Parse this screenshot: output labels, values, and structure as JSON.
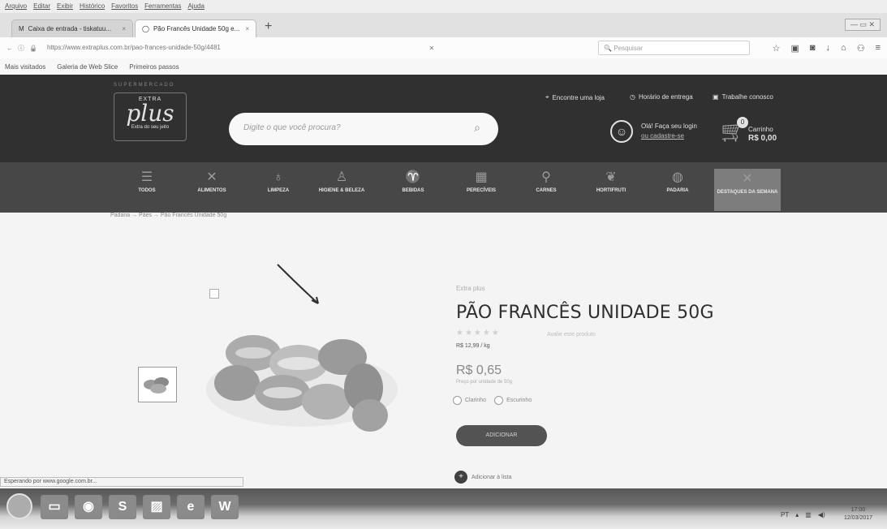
{
  "browser": {
    "menu": [
      "Arquivo",
      "Editar",
      "Exibir",
      "Histórico",
      "Favoritos",
      "Ferramentas",
      "Ajuda"
    ],
    "tabs": [
      {
        "label": "Caixa de entrada - tiskatuu...",
        "active": false
      },
      {
        "label": "Pão Francês Unidade 50g e...",
        "active": true
      }
    ],
    "url": "https://www.extraplus.com.br/pao-frances-unidade-50g/4481",
    "search_placeholder": "Pesquisar",
    "bookmarks": [
      "Mais visitados",
      "Galeria de Web Slice",
      "Primeiros passos"
    ],
    "status": "Esperando por www.google.com.br..."
  },
  "header": {
    "logo_top": "EXTRA",
    "logo_main": "plus",
    "logo_tag": "Extra do seu jeito",
    "logo_tagline": "SUPERMERCADO",
    "links": [
      "Encontre uma loja",
      "Horário de entrega",
      "Trabalhe conosco"
    ],
    "search_placeholder": "Digite o que você procura?",
    "account_greeting": "Olá! Faça seu login",
    "account_register": "ou cadastre-se",
    "cart_count": "0",
    "cart_label": "Carrinho",
    "cart_total": "R$ 0,00"
  },
  "categories": [
    {
      "label": "TODOS",
      "icon": "menu-icon"
    },
    {
      "label": "ALIMENTOS",
      "icon": "fork-knife-icon"
    },
    {
      "label": "LIMPEZA",
      "icon": "spray-bottle-icon"
    },
    {
      "label": "HIGIENE & BELEZA",
      "icon": "soap-icon"
    },
    {
      "label": "BEBIDAS",
      "icon": "glass-icon"
    },
    {
      "label": "PERECÍVEIS",
      "icon": "fridge-icon"
    },
    {
      "label": "CARNES",
      "icon": "meat-icon"
    },
    {
      "label": "HORTIFRUTI",
      "icon": "vegetable-icon"
    },
    {
      "label": "PADARIA",
      "icon": "bread-icon"
    },
    {
      "label": "DESTAQUES DA SEMANA",
      "icon": "star-icon",
      "active": true
    }
  ],
  "breadcrumb": [
    "Padaria",
    "Pães",
    "Pão Francês Unidade 50g"
  ],
  "product": {
    "brand": "Extra plus",
    "title": "PÃO FRANCÊS UNIDADE 50G",
    "stars": "★★★★★",
    "review_link": "Avalie este produto",
    "price_per_kg": "R$ 12,99 / kg",
    "price": "R$ 0,65",
    "price_note": "Preço por unidade de 50g",
    "options": [
      "Clarinho",
      "Escurinho"
    ],
    "add_button": "ADICIONAR",
    "add_list": "Adicionar à lista"
  },
  "taskbar": {
    "apps": [
      "folder-icon",
      "media-icon",
      "skype-icon",
      "photo-icon",
      "ie-icon",
      "word-icon"
    ],
    "tray_lang": "PT",
    "time": "17:00",
    "date": "12/03/2017"
  }
}
